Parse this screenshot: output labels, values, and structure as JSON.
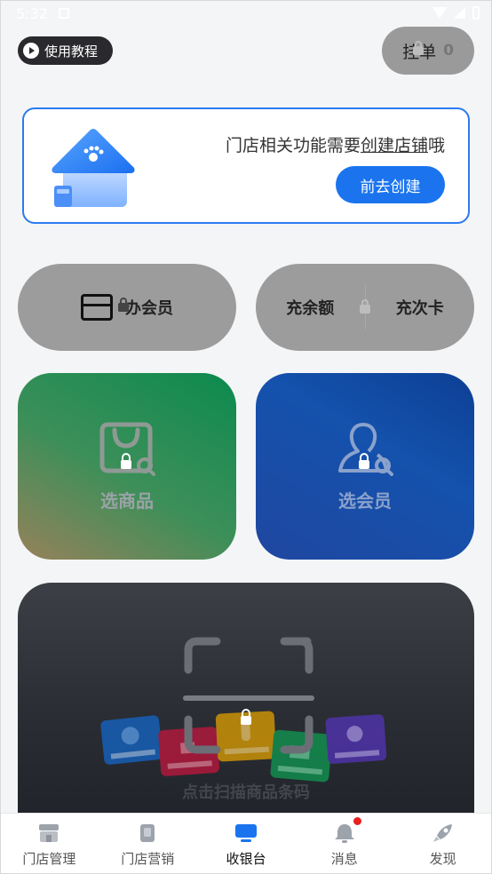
{
  "status_bar": {
    "time": "5:32"
  },
  "header": {
    "tutorial_label": "使用教程",
    "hang_label": "挂单",
    "hang_count": "0"
  },
  "store_notice": {
    "text_prefix": "门店相关功能需要",
    "text_link": "创建店铺",
    "text_suffix": "哦",
    "button_label": "前去创建"
  },
  "quick_actions": {
    "open_member_label": "办会员",
    "recharge_balance_label": "充余额",
    "recharge_times_label": "充次卡"
  },
  "tiles": {
    "select_goods_label": "选商品",
    "select_member_label": "选会员"
  },
  "scan": {
    "label": "点击扫描商品条码"
  },
  "colors": {
    "accent": "#1b74ee",
    "card_border": "#2d7af0",
    "badge": "#e82020"
  },
  "bottom_nav": {
    "items": [
      {
        "label": "门店管理",
        "icon": "store-icon"
      },
      {
        "label": "门店营销",
        "icon": "marketing-icon"
      },
      {
        "label": "收银台",
        "icon": "cashier-icon",
        "active": true
      },
      {
        "label": "消息",
        "icon": "bell-icon",
        "badge": true
      },
      {
        "label": "发现",
        "icon": "rocket-icon"
      }
    ]
  }
}
